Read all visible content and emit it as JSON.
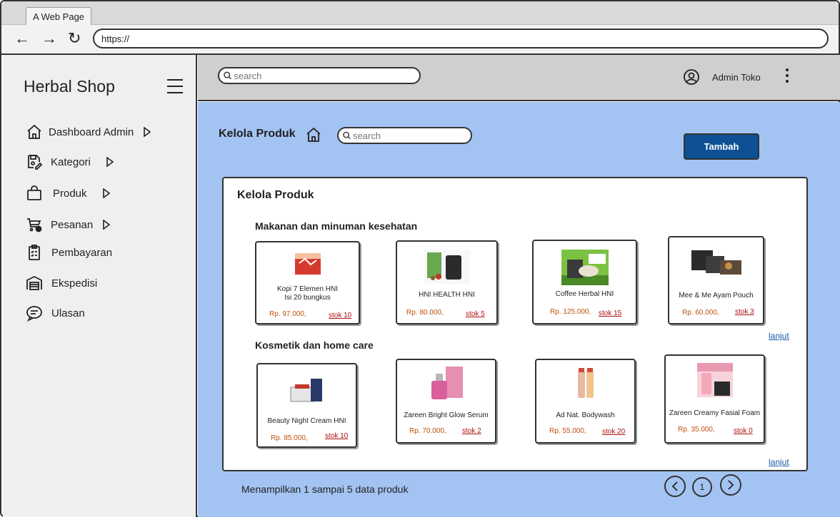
{
  "browser": {
    "tab_title": "A Web Page",
    "url": "https://"
  },
  "sidebar": {
    "brand": "Herbal Shop",
    "items": [
      {
        "label": "Dashboard Admin",
        "icon": "home-icon",
        "has_caret": true
      },
      {
        "label": "Kategori",
        "icon": "save-edit-icon",
        "has_caret": true
      },
      {
        "label": "Produk",
        "icon": "shopping-bag-icon",
        "has_caret": true
      },
      {
        "label": "Pesanan",
        "icon": "cart-icon",
        "has_caret": true
      },
      {
        "label": "Pembayaran",
        "icon": "clipboard-list-icon",
        "has_caret": false
      },
      {
        "label": "Ekspedisi",
        "icon": "warehouse-icon",
        "has_caret": false
      },
      {
        "label": "Ulasan",
        "icon": "chat-icon",
        "has_caret": false
      }
    ]
  },
  "header": {
    "search_placeholder": "search",
    "admin_name": "Admin Toko"
  },
  "main": {
    "page_title": "Kelola Produk",
    "search_placeholder": "search",
    "add_button": "Tambah",
    "panel_title": "Kelola Produk",
    "categories": [
      {
        "title": "Makanan dan minuman kesehatan",
        "more_label": "lanjut",
        "products": [
          {
            "name": "Kopi 7 Elemen HNI\nIsi 20 bungkus",
            "price": "Rp. 97.000,",
            "stock": "stok 10"
          },
          {
            "name": "HNI HEALTH HNI",
            "price": "Rp. 80.000,",
            "stock": "stok 5"
          },
          {
            "name": "Coffee Herbal HNI",
            "price": "Rp. 125.000,",
            "stock": "stok 15"
          },
          {
            "name": "Mee & Me Ayam Pouch",
            "price": "Rp. 60.000,",
            "stock": "stok 3"
          }
        ]
      },
      {
        "title": "Kosmetik dan home care",
        "more_label": "lanjut",
        "products": [
          {
            "name": "Beauty Night Cream HNI",
            "price": "Rp. 85.000,",
            "stock": "stok 10"
          },
          {
            "name": "Zareen Bright Glow Serum",
            "price": "Rp. 70.000,",
            "stock": "stok 2"
          },
          {
            "name": "Ad Nat. Bodywash",
            "price": "Rp. 55.000,",
            "stock": "stok 20"
          },
          {
            "name": "Zareen Creamy Fasial Foam",
            "price": "Rp. 35.000,",
            "stock": "stok 0"
          }
        ]
      }
    ],
    "footer_text": "Menampilkan 1 sampai 5 data produk",
    "pagination": {
      "current_page": "1"
    }
  },
  "colors": {
    "main_bg": "#a3c3f2",
    "header_bg": "#cfcfcf",
    "sidebar_bg": "#efefef",
    "primary_button": "#0d5194",
    "price_text": "#c0500a",
    "stock_text": "#b01010",
    "link": "#1a5aa8"
  }
}
